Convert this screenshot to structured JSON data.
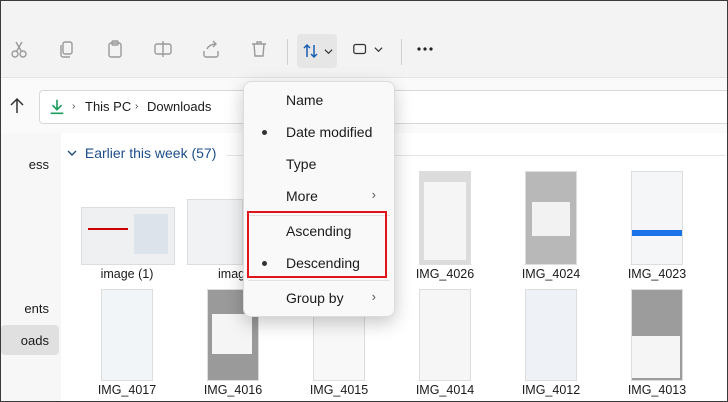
{
  "toolbar": {
    "icons": [
      "cut-icon",
      "copy-icon",
      "paste-icon",
      "rename-icon",
      "share-icon",
      "delete-icon",
      "sort-icon",
      "chevron-down-icon",
      "view-icon",
      "chevron-down-icon",
      "more-icon"
    ]
  },
  "address": {
    "segments": [
      "This PC",
      "Downloads"
    ]
  },
  "sidebar": {
    "items": [
      {
        "label": "ess"
      },
      {
        "label": "ents"
      },
      {
        "label": "oads"
      }
    ]
  },
  "group": {
    "title": "Earlier this week (57)"
  },
  "files": {
    "row1": [
      "image (1)",
      "imag",
      "IMG_4026",
      "IMG_4024",
      "IMG_4023"
    ],
    "row2": [
      "IMG_4017",
      "IMG_4016",
      "IMG_4015",
      "IMG_4014",
      "IMG_4012",
      "IMG_4013"
    ]
  },
  "sort_menu": {
    "items": [
      {
        "label": "Name",
        "checked": false
      },
      {
        "label": "Date modified",
        "checked": true
      },
      {
        "label": "Type",
        "checked": false
      },
      {
        "label": "More",
        "submenu": true
      },
      {
        "label": "Ascending",
        "checked": false
      },
      {
        "label": "Descending",
        "checked": true
      },
      {
        "label": "Group by",
        "submenu": true
      }
    ],
    "submenu_glyph": "›"
  },
  "colors": {
    "highlight": "#e0141b",
    "group_title": "#1c4e8a",
    "accent_green": "#1a9c5b"
  }
}
